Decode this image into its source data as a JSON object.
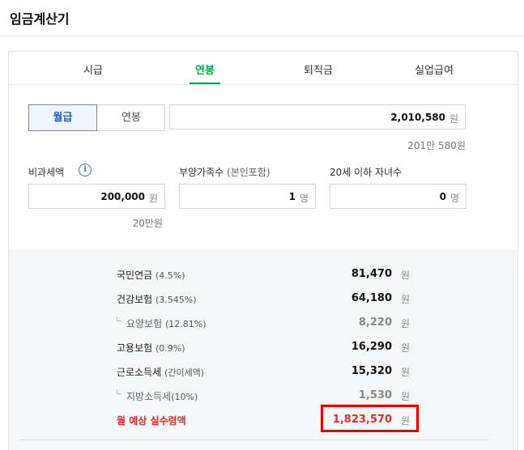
{
  "title": "임금계산기",
  "tabs": [
    {
      "label": "시급"
    },
    {
      "label": "연봉"
    },
    {
      "label": "퇴직금"
    },
    {
      "label": "실업급여"
    }
  ],
  "active_tab": "연봉",
  "pay_period": {
    "options": [
      "월급",
      "연봉"
    ],
    "selected": "월급"
  },
  "salary": {
    "value": "2,010,580",
    "unit": "원",
    "hint": "201만 580원"
  },
  "nontaxable": {
    "label": "비과세액",
    "value": "200,000",
    "unit": "원",
    "hint": "20만원"
  },
  "dependents": {
    "label": "부양가족수",
    "label_note": "(본인포함)",
    "value": "1",
    "unit": "명"
  },
  "children": {
    "label": "20세 이하 자녀수",
    "value": "0",
    "unit": "명"
  },
  "deductions": [
    {
      "name": "국민연금",
      "rate": "(4.5%)",
      "amount": "81,470",
      "unit": "원",
      "sub": false
    },
    {
      "name": "건강보험",
      "rate": "(3.545%)",
      "amount": "64,180",
      "unit": "원",
      "sub": false
    },
    {
      "name": "요양보험",
      "rate": "(12.81%)",
      "amount": "8,220",
      "unit": "원",
      "sub": true
    },
    {
      "name": "고용보험",
      "rate": "(0.9%)",
      "amount": "16,290",
      "unit": "원",
      "sub": false
    },
    {
      "name": "근로소득세",
      "rate": "(간이세액)",
      "amount": "15,320",
      "unit": "원",
      "sub": false
    },
    {
      "name": "지방소득세",
      "rate": "(10%)",
      "amount": "1,530",
      "unit": "원",
      "sub": true
    }
  ],
  "net_pay": {
    "label": "월 예상 실수령액",
    "amount": "1,823,570",
    "unit": "원"
  },
  "colors": {
    "accent_green": "#03a94d",
    "accent_blue": "#4a8eea",
    "net_red": "#e02b2b",
    "highlight_box": "#ee0000"
  }
}
